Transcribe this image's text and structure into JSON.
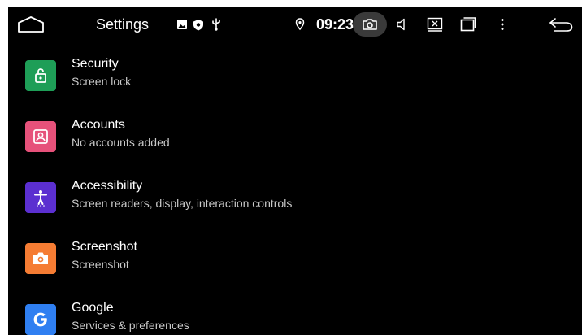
{
  "status_bar": {
    "title": "Settings",
    "time": "09:23",
    "icons": [
      "home-icon",
      "image-icon",
      "shield-icon",
      "usb-icon",
      "location-icon",
      "camera-icon",
      "volume-icon",
      "close-window-icon",
      "window-icon",
      "more-icon",
      "back-icon"
    ]
  },
  "settings": {
    "items": [
      {
        "title": "Security",
        "subtitle": "Screen lock",
        "icon": "lock-icon",
        "color": "#1e9e57"
      },
      {
        "title": "Accounts",
        "subtitle": "No accounts added",
        "icon": "account-icon",
        "color": "#e6517a"
      },
      {
        "title": "Accessibility",
        "subtitle": "Screen readers, display, interaction controls",
        "icon": "accessibility-icon",
        "color": "#5b2fd0"
      },
      {
        "title": "Screenshot",
        "subtitle": "Screenshot",
        "icon": "camera-icon",
        "color": "#f57c33"
      },
      {
        "title": "Google",
        "subtitle": "Services & preferences",
        "icon": "google-icon",
        "color": "#2f7ff1"
      }
    ]
  }
}
